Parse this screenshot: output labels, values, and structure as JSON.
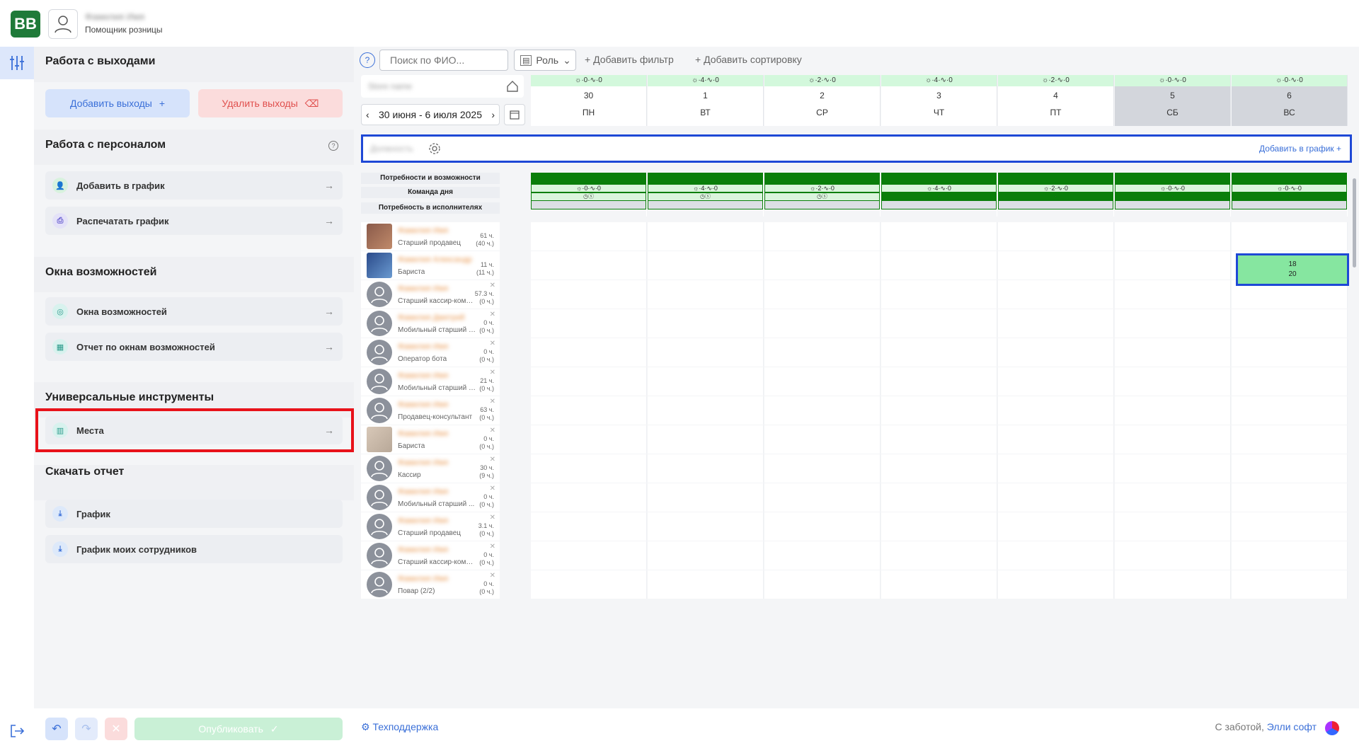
{
  "app": {
    "logo": "BB",
    "user_name": "Фамилия Имя",
    "user_role": "Помощник розницы"
  },
  "sidebar": {
    "shifts_title": "Работа с выходами",
    "add_shifts": "Добавить выходы",
    "delete_shifts": "Удалить выходы",
    "staff_title": "Работа с персоналом",
    "staff_help": "?",
    "add_to_schedule": "Добавить в график",
    "print_schedule": "Распечатать график",
    "windows_title": "Окна возможностей",
    "windows": "Окна возможностей",
    "windows_report": "Отчет по окнам возможностей",
    "tools_title": "Универсальные инструменты",
    "places": "Места",
    "download_title": "Скачать отчет",
    "schedule_report": "График",
    "my_employees_report": "График моих сотрудников"
  },
  "bottombar": {
    "publish": "Опубликовать",
    "support": "Техподдержка",
    "care_prefix": "С заботой,",
    "care_brand": "Элли софт"
  },
  "toolbar": {
    "search_placeholder": "Поиск по ФИО...",
    "role": "Роль",
    "add_filter": "Добавить фильтр",
    "add_sort": "Добавить сортировку"
  },
  "schedule": {
    "store": "Store name",
    "week": "30 июня - 6 июля 2025",
    "position": "Должность",
    "add_to_schedule": "Добавить в график",
    "needs_label": "Потребности и возможности",
    "team_label": "Команда дня",
    "performers_label": "Потребность в исполнителях",
    "days": [
      {
        "num": "30",
        "wd": "ПН",
        "wx": "☼·0·∿·0",
        "need": "☼·0·∿·0",
        "weekend": false
      },
      {
        "num": "1",
        "wd": "ВТ",
        "wx": "☼·4·∿·0",
        "need": "☼·4·∿·0",
        "weekend": false
      },
      {
        "num": "2",
        "wd": "СР",
        "wx": "☼·2·∿·0",
        "need": "☼·2·∿·0",
        "weekend": false
      },
      {
        "num": "3",
        "wd": "ЧТ",
        "wx": "☼·4·∿·0",
        "need": "☼·4·∿·0",
        "weekend": false
      },
      {
        "num": "4",
        "wd": "ПТ",
        "wx": "☼·2·∿·0",
        "need": "☼·2·∿·0",
        "weekend": false
      },
      {
        "num": "5",
        "wd": "СБ",
        "wx": "☼·0·∿·0",
        "need": "☼·0·∿·0",
        "weekend": true
      },
      {
        "num": "6",
        "wd": "ВС",
        "wx": "☼·0·∿·0",
        "need": "☼·0·∿·0",
        "weekend": true
      }
    ],
    "employees": [
      {
        "name": "Фамилия Имя",
        "role": "Старший продавец",
        "h1": "61 ч.",
        "h2": "(40 ч.)",
        "photo": "brown",
        "x": false
      },
      {
        "name": "Фамилия Александр",
        "role": "Бариста",
        "h1": "11 ч.",
        "h2": "(11 ч.)",
        "photo": "blue",
        "x": false
      },
      {
        "name": "Фамилия Имя",
        "role": "Старший кассир-компле...",
        "h1": "57.3 ч.",
        "h2": "(0 ч.)",
        "photo": "none",
        "x": true
      },
      {
        "name": "Фамилия Дмитрий",
        "role": "Мобильный старший про...",
        "h1": "0 ч.",
        "h2": "(0 ч.)",
        "photo": "none",
        "x": true
      },
      {
        "name": "Фамилия Имя",
        "role": "Оператор бота",
        "h1": "0 ч.",
        "h2": "(0 ч.)",
        "photo": "none",
        "x": true
      },
      {
        "name": "Фамилия Имя",
        "role": "Мобильный старший про...",
        "h1": "21 ч.",
        "h2": "(0 ч.)",
        "photo": "none",
        "x": true
      },
      {
        "name": "Фамилия Имя",
        "role": "Продавец-консультант",
        "h1": "63 ч.",
        "h2": "(0 ч.)",
        "photo": "none",
        "x": true
      },
      {
        "name": "Фамилия Имя",
        "role": "Бариста",
        "h1": "0 ч.",
        "h2": "(0 ч.)",
        "photo": "beige",
        "x": true
      },
      {
        "name": "Фамилия Имя",
        "role": "Кассир",
        "h1": "30 ч.",
        "h2": "(9 ч.)",
        "photo": "none",
        "x": true
      },
      {
        "name": "Фамилия Имя",
        "role": "Мобильный старший ...",
        "h1": "0 ч.",
        "h2": "(0 ч.)",
        "photo": "none",
        "x": true
      },
      {
        "name": "Фамилия Имя",
        "role": "Старший продавец",
        "h1": "3.1 ч.",
        "h2": "(0 ч.)",
        "photo": "none",
        "x": true
      },
      {
        "name": "Фамилия Имя",
        "role": "Старший кассир-компле...",
        "h1": "0 ч.",
        "h2": "(0 ч.)",
        "photo": "none",
        "x": true
      },
      {
        "name": "Фамилия Имя",
        "role": "Повар (2/2)",
        "h1": "0 ч.",
        "h2": "(0 ч.)",
        "photo": "none",
        "x": true
      }
    ],
    "shift": {
      "start": "18",
      "end": "20"
    }
  }
}
